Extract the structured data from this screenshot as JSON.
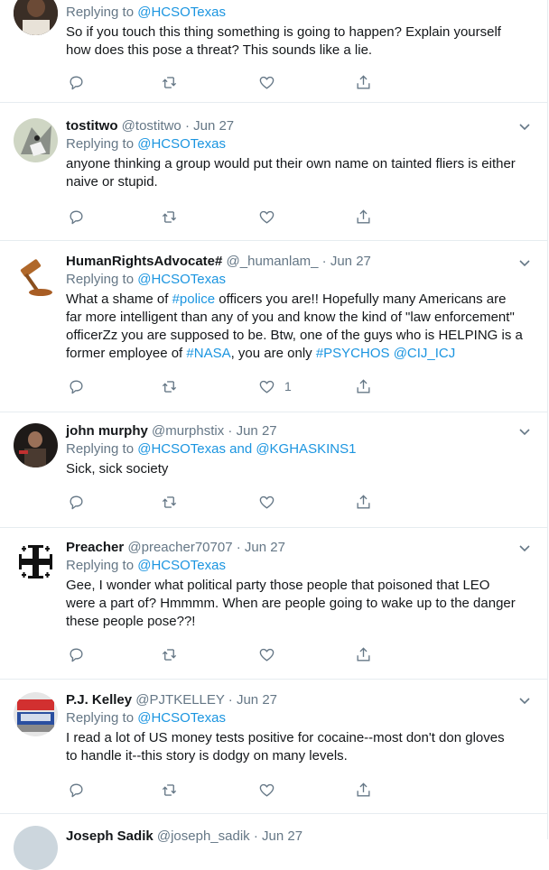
{
  "tweets": [
    {
      "name": "",
      "handle": "",
      "date": "",
      "reply_prefix": "Replying to ",
      "reply_to": "@HCSOTexas",
      "text_lines": [
        "So if you touch this thing something is going to happen? Explain yourself",
        "how does this pose a threat? This sounds like a lie."
      ],
      "likes": ""
    },
    {
      "name": "tostitwo",
      "handle": "@tostitwo",
      "date": "Jun 27",
      "reply_prefix": "Replying to ",
      "reply_to": "@HCSOTexas",
      "text_lines": [
        "anyone thinking a group would put their own name on tainted fliers is either",
        "naive or stupid."
      ],
      "likes": ""
    },
    {
      "name": "HumanRightsAdvocate#",
      "handle": "@_humanlam_",
      "date": "Jun 27",
      "reply_prefix": "Replying to ",
      "reply_to": "@HCSOTexas",
      "text_segments": [
        {
          "t": "What a shame of ",
          "l": false
        },
        {
          "t": "#police",
          "l": true
        },
        {
          "t": " officers you are!! Hopefully many Americans are",
          "l": false
        },
        {
          "t": "\n",
          "l": false
        },
        {
          "t": "far more intelligent than any of you and know the kind of \"law enforcement\"",
          "l": false
        },
        {
          "t": "\n",
          "l": false
        },
        {
          "t": "officerZz you are supposed to be. Btw, one of the guys who is HELPING is a",
          "l": false
        },
        {
          "t": "\n",
          "l": false
        },
        {
          "t": "former employee of ",
          "l": false
        },
        {
          "t": "#NASA",
          "l": true
        },
        {
          "t": ", you are only ",
          "l": false
        },
        {
          "t": "#PSYCHOS",
          "l": true
        },
        {
          "t": " ",
          "l": false
        },
        {
          "t": "@CIJ_ICJ",
          "l": true
        }
      ],
      "likes": "1"
    },
    {
      "name": "john murphy",
      "handle": "@murphstix",
      "date": "Jun 27",
      "reply_prefix": "Replying to ",
      "reply_to": "@HCSOTexas and @KGHASKINS1",
      "text_lines": [
        "Sick, sick society"
      ],
      "likes": ""
    },
    {
      "name": "Preacher",
      "handle": "@preacher70707",
      "date": "Jun 27",
      "reply_prefix": "Replying to ",
      "reply_to": "@HCSOTexas",
      "text_lines": [
        "Gee, I wonder what political party those people that poisoned that LEO",
        "were a part of?  Hmmmm.  When are people going to wake up to the danger",
        "these people pose??!"
      ],
      "likes": ""
    },
    {
      "name": "P.J. Kelley",
      "handle": "@PJTKELLEY",
      "date": "Jun 27",
      "reply_prefix": "Replying to ",
      "reply_to": "@HCSOTexas",
      "text_lines": [
        "I read a lot of US money tests positive for cocaine--most don't don gloves",
        "to handle it--this story is dodgy on many levels."
      ],
      "likes": ""
    },
    {
      "name": "Joseph Sadik",
      "handle": "@joseph_sadik",
      "date": "Jun 27",
      "reply_prefix": "",
      "reply_to": "",
      "text_lines": [],
      "likes": ""
    }
  ],
  "dot": "·",
  "icons": [
    "reply-icon",
    "retweet-icon",
    "like-icon",
    "share-icon",
    "caret-down-icon"
  ],
  "colors": {
    "link": "#1b95e0",
    "muted": "#657786",
    "border": "#e6ecf0"
  }
}
